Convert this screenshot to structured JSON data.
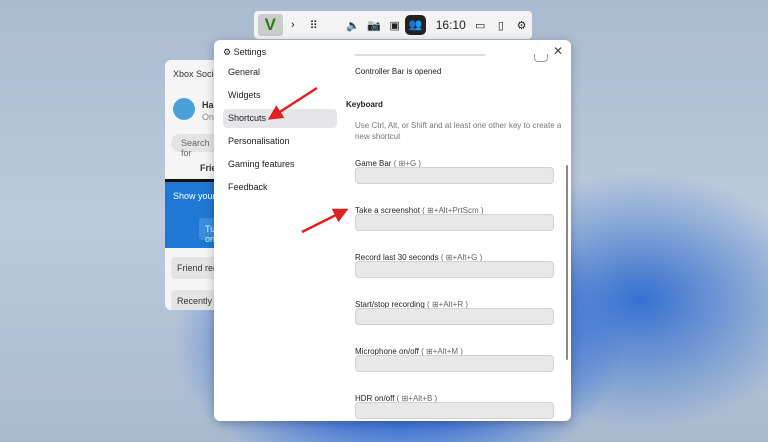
{
  "gamebar": {
    "time": "16:10",
    "chevron": "›"
  },
  "social": {
    "title": "Xbox Social",
    "user": "Hal",
    "status": "Online",
    "search": "Search for",
    "tab": "Friends",
    "promo": "Show your ... by turning ...",
    "promo_btn": "Turn on",
    "friend_requests": "Friend requests",
    "recently": "Recently"
  },
  "settings": {
    "title": "Settings",
    "nav": [
      "General",
      "Widgets",
      "Shortcuts",
      "Personalisation",
      "Gaming features",
      "Feedback"
    ],
    "selected": "Shortcuts",
    "top_text": "Controller Bar is opened",
    "section": "Keyboard",
    "hint": "Use Ctrl, Alt, or Shift and at least one other key to create a new shortcut",
    "shortcuts": [
      {
        "label": "Game Bar",
        "keys": "+G"
      },
      {
        "label": "Take a screenshot",
        "keys": "+Alt+PrtScm"
      },
      {
        "label": "Record last 30 seconds",
        "keys": "+Alt+G"
      },
      {
        "label": "Start/stop recording",
        "keys": "+Alt+R"
      },
      {
        "label": "Microphone on/off",
        "keys": "+Alt+M"
      },
      {
        "label": "HDR on/off",
        "keys": "+Alt+B"
      }
    ]
  },
  "colors": {
    "arrow": "#e02020",
    "promo": "#1e78d4"
  }
}
